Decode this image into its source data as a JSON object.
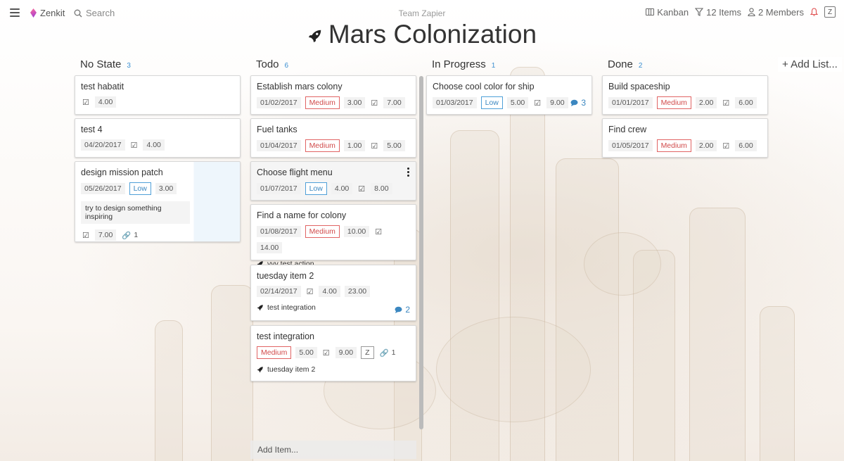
{
  "topbar": {
    "logo_text": "Zenkit",
    "search_placeholder": "Search",
    "team": "Team Zapier",
    "kanban_label": "Kanban",
    "items_label": "12 Items",
    "members_label": "2 Members",
    "user_initial": "Z"
  },
  "page": {
    "title": "Mars Colonization"
  },
  "add_list_label": "+ Add List...",
  "add_item_label": "Add Item...",
  "colors": {
    "accent": "#3b8fd1",
    "medium": "#d14b4b",
    "low": "#3b87c0"
  },
  "columns": [
    {
      "name": "No State",
      "count": "3",
      "cards": [
        {
          "title": "test habatit",
          "checked": "4.00"
        },
        {
          "title": "test 4",
          "date": "04/20/2017",
          "checked": "4.00"
        },
        {
          "title": "design mission patch",
          "date": "05/26/2017",
          "priority": "Low",
          "value": "3.00",
          "note": "try to design something inspiring",
          "checked": "7.00",
          "attachments": "1"
        }
      ]
    },
    {
      "name": "Todo",
      "count": "6",
      "cards": [
        {
          "title": "Establish mars colony",
          "date": "01/02/2017",
          "priority": "Medium",
          "value": "3.00",
          "checked": "7.00"
        },
        {
          "title": "Fuel tanks",
          "date": "01/04/2017",
          "priority": "Medium",
          "value": "1.00",
          "checked": "5.00"
        },
        {
          "title": "Choose flight menu",
          "date": "01/07/2017",
          "priority": "Low",
          "value": "4.00",
          "checked": "8.00"
        },
        {
          "title": "Find a name for colony",
          "date": "01/08/2017",
          "priority": "Medium",
          "value": "10.00",
          "checked": "14.00",
          "action": "vvv test action"
        },
        {
          "title": "tuesday item 2",
          "date": "02/14/2017",
          "checked": "4.00",
          "total": "23.00",
          "action": "test integration",
          "comments": "2"
        },
        {
          "title": "test integration",
          "priority": "Medium",
          "value": "5.00",
          "checked": "9.00",
          "user": "Z",
          "attachments": "1",
          "action": "tuesday item 2"
        }
      ]
    },
    {
      "name": "In Progress",
      "count": "1",
      "cards": [
        {
          "title": "Choose cool color for ship",
          "date": "01/03/2017",
          "priority": "Low",
          "value": "5.00",
          "checked": "9.00",
          "comments": "3"
        }
      ]
    },
    {
      "name": "Done",
      "count": "2",
      "cards": [
        {
          "title": "Build spaceship",
          "date": "01/01/2017",
          "priority": "Medium",
          "value": "2.00",
          "checked": "6.00"
        },
        {
          "title": "Find crew",
          "date": "01/05/2017",
          "priority": "Medium",
          "value": "2.00",
          "checked": "6.00"
        }
      ]
    }
  ]
}
